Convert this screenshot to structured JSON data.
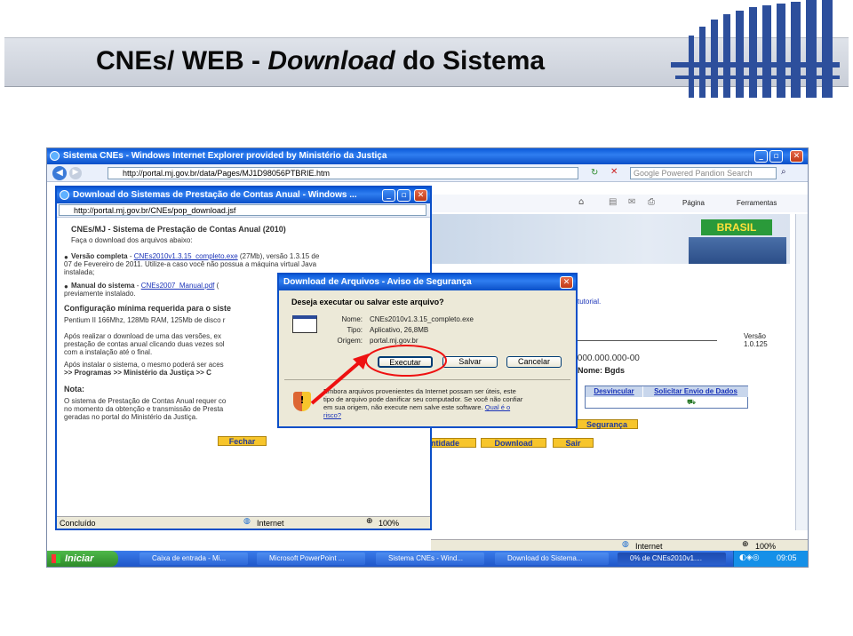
{
  "slide": {
    "title_prefix": "CNEs/ WEB - ",
    "title_italic": "Download",
    "title_suffix": " do Sistema"
  },
  "browser": {
    "title": "Sistema CNEs - Windows Internet Explorer provided by Ministério da Justiça",
    "address": "http://portal.mj.gov.br/data/Pages/MJ1D98056PTBRIE.htm",
    "search_placeholder": "Google Powered Pandion Search",
    "toolbar_page": "Página",
    "toolbar_tools": "Ferramentas",
    "brand": "BRASIL",
    "right_text_tutorial": "tutorial.",
    "version_label": "Versão",
    "version_value": "1.0.125",
    "cnpj_text": ".000.000.000-00",
    "name_text": "Nome: Bgds",
    "table_headers": [
      "Desvincular",
      "Solicitar Envio de Dados"
    ],
    "btn_seguranca": "Segurança",
    "btn_entidade": "ntidade",
    "btn_download": "Download",
    "btn_sair": "Sair",
    "status_zone": "Internet",
    "status_zoom": "100%"
  },
  "popup": {
    "title": "Download do Sistemas de Prestação de Contas Anual - Windows ...",
    "address": "http://portal.mj.gov.br/CNEs/pop_download.jsf",
    "heading": "CNEs/MJ - Sistema de Prestação de Contas Anual (2010)",
    "intro": "Faça o download dos arquivos abaixo:",
    "item1_label": "Versão completa",
    "item1_dash": " - ",
    "item1_link": "CNEs2010v1.3.15_completo.exe",
    "item1_rest": " (27Mb), versão 1.3.15 de",
    "item1_line2": "07 de Fevereiro de 2011. Utilize-a caso você não possua a máquina virtual Java",
    "item1_line3": "instalada;",
    "item2_label": "Manual do sistema",
    "item2_dash": " - ",
    "item2_link": "CNEs2007_Manual.pdf",
    "item2_rest": " (",
    "item2_line2": "previamente instalado.",
    "config_heading": "Configuração mínima requerida para o siste",
    "config_text": "Pentium II 166Mhz, 128Mb RAM, 125Mb de disco r",
    "after1": "Após realizar o download de uma das versões, ex",
    "after2": "prestação de contas anual clicando duas vezes sol",
    "after3": "com a instalação até o final.",
    "after4": "Após instalar o sistema, o mesmo poderá ser aces",
    "after5": ">> Programas >> Ministério da Justiça >> C",
    "nota_heading": "Nota:",
    "nota1": "O sistema de Prestação de Contas Anual requer co",
    "nota2": "no momento da obtenção e transmissão de Presta",
    "nota3": "geradas no portal do Ministério da Justiça.",
    "close_btn": "Fechar",
    "status_left": "Concluído",
    "status_zone": "Internet",
    "status_zoom": "100%"
  },
  "dialog": {
    "title": "Download de Arquivos - Aviso de Segurança",
    "question": "Deseja executar ou salvar este arquivo?",
    "name_label": "Nome:",
    "name_value": "CNEs2010v1.3.15_completo.exe",
    "type_label": "Tipo:",
    "type_value": "Aplicativo, 26,8MB",
    "origin_label": "Origem:",
    "origin_value": "portal.mj.gov.br",
    "btn_run": "Executar",
    "btn_save": "Salvar",
    "btn_cancel": "Cancelar",
    "warning_line1": "Embora arquivos provenientes da Internet possam ser úteis, este",
    "warning_line2": "tipo de arquivo pode danificar seu computador. Se você não confiar",
    "warning_line3_a": "em sua origem, não execute nem salve este software. ",
    "warning_link_a": "Qual é o",
    "warning_link_b": "risco?"
  },
  "taskbar": {
    "start": "Iniciar",
    "items": [
      "Caixa de entrada - Mi...",
      "Microsoft PowerPoint ...",
      "Sistema CNEs - Wind...",
      "Download do Sistema...",
      "0% de CNEs2010v1...."
    ],
    "clock": "09:05"
  }
}
